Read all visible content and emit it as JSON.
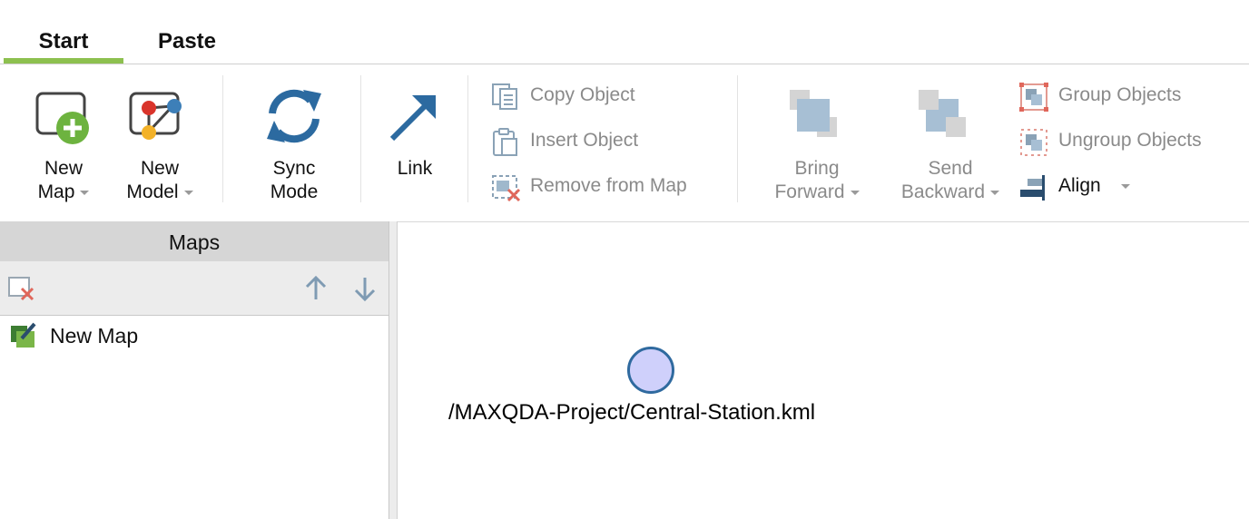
{
  "tabs": [
    {
      "label": "Start",
      "active": true
    },
    {
      "label": "Paste",
      "active": false
    }
  ],
  "accent_color": "#8dc04f",
  "ribbon": {
    "new_map": {
      "line1": "New",
      "line2": "Map",
      "icon": "new-map-icon"
    },
    "new_model": {
      "line1": "New",
      "line2": "Model",
      "icon": "new-model-icon"
    },
    "sync_mode": {
      "line1": "Sync",
      "line2": "Mode",
      "icon": "sync-icon"
    },
    "link": {
      "label": "Link",
      "icon": "link-arrow-icon"
    },
    "copy_object": "Copy Object",
    "insert_object": "Insert Object",
    "remove_from_map": "Remove from Map",
    "bring_forward": {
      "line1": "Bring",
      "line2": "Forward"
    },
    "send_backward": {
      "line1": "Send",
      "line2": "Backward"
    },
    "group_objects": "Group Objects",
    "ungroup_objects": "Ungroup Objects",
    "align": "Align"
  },
  "panel": {
    "title": "Maps",
    "items": [
      {
        "label": "New Map",
        "icon": "map-edit-icon"
      }
    ]
  },
  "canvas": {
    "node_label": "/MAXQDA-Project/Central-Station.kml",
    "node_fill": "#cfd0fb",
    "node_stroke": "#2f6a9f"
  }
}
